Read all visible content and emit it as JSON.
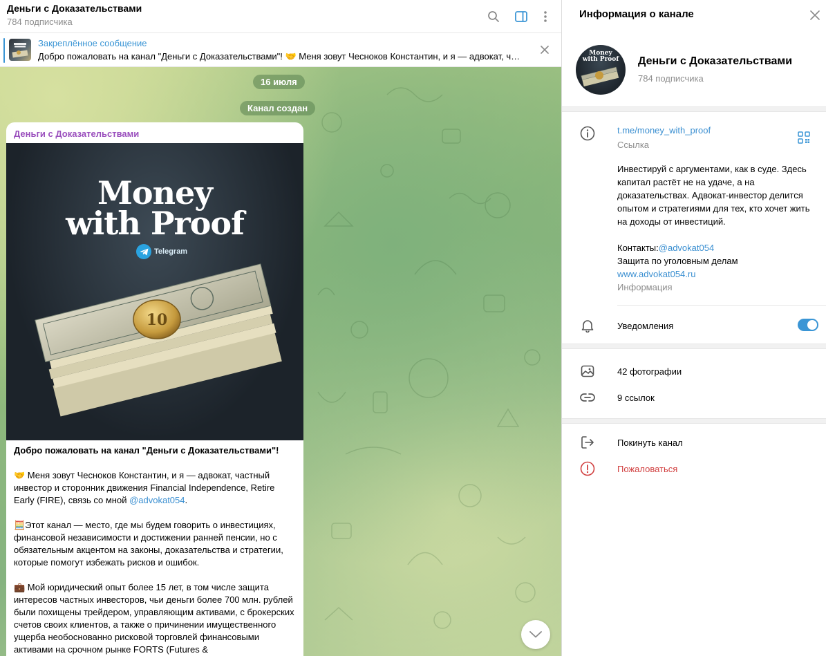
{
  "chat": {
    "title": "Деньги с Доказательствами",
    "subscribers": "784 подписчика"
  },
  "pinned": {
    "label": "Закреплённое сообщение",
    "text": "Добро пожаловать на канал \"Деньги с Доказательствами\"!  🤝 Меня зовут Чесноков Константин, и я — адвокат, частный инвестор и сторонник движения Financial Independence"
  },
  "feed": {
    "date": "16 июля",
    "service": "Канал создан"
  },
  "message": {
    "author": "Деньги с Доказательствами",
    "image_title_1": "Money",
    "image_title_2": "with Proof",
    "image_brand": "Telegram",
    "coin": "10",
    "heading": "Добро пожаловать на канал \"Деньги с Доказательствами\"!",
    "p1": "🤝 Меня зовут Чесноков Константин, и я — адвокат, частный инвестор и сторонник движения Financial Independence, Retire Early (FIRE), связь со мной ",
    "p1_link": "@advokat054",
    "p1_end": ".",
    "p2": "🧮Этот канал — место, где мы будем говорить о инвестициях, финансовой независимости и достижении ранней пенсии, но с обязательным акцентом на законы, доказательства и стратегии, которые помогут избежать рисков и ошибок.",
    "p3": "💼 Мой юридический опыт более 15 лет, в том числе защита интересов частных инвесторов, чьи деньги более 700 млн. рублей были похищены трейдером, управляющим активами, с брокерских счетов своих клиентов, а также о причинении имущественного ущерба необоснованно рисковой торговлей финансовыми активами на срочном рынке FORTS (Futures &"
  },
  "info": {
    "header": "Информация о канале",
    "name": "Деньги с Доказательствами",
    "subscribers": "784 подписчика",
    "avatar_text_1": "Money",
    "avatar_text_2": "with Proof",
    "link": "t.me/money_with_proof",
    "link_caption": "Ссылка",
    "description": "Инвестируй с аргументами, как в суде. Здесь капитал растёт не на удаче, а на доказательствах. Адвокат-инвестор  делится опытом и стратегиями для тех, кто хочет жить на доходы от инвестиций.",
    "contacts_label": "Контакты:",
    "contacts_link": "@advokat054",
    "defense": "Защита по уголовным делам",
    "site": "www.advokat054.ru",
    "desc_caption": "Информация",
    "notifications": "Уведомления",
    "notifications_on": true,
    "photos": "42 фотографии",
    "links": "9 ссылок",
    "leave": "Покинуть канал",
    "report": "Пожаловаться"
  },
  "colors": {
    "accent": "#3a95d5",
    "author": "#9a4fbd",
    "danger": "#d14040"
  }
}
